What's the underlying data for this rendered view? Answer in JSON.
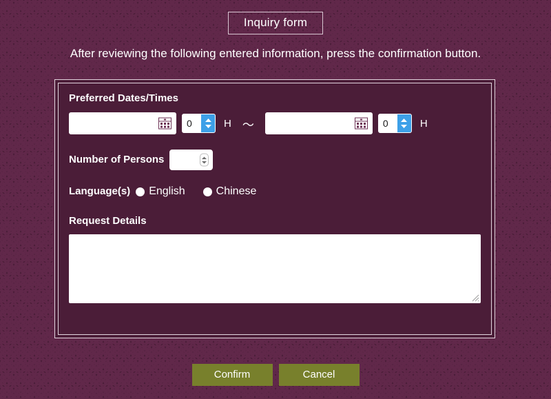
{
  "header": {
    "title": "Inquiry form",
    "instruction": "After reviewing the following entered information, press the confirmation button."
  },
  "form": {
    "fields": {
      "preferred_dates": {
        "label": "Preferred Dates/Times",
        "start": {
          "date_value": "",
          "date_icon": "calendar-icon",
          "hour_value": "0",
          "hour_unit": "H",
          "spinner_icon": "updown-chevron-icon"
        },
        "separator": "〜",
        "end": {
          "date_value": "",
          "date_icon": "calendar-icon",
          "hour_value": "0",
          "hour_unit": "H",
          "spinner_icon": "updown-chevron-icon"
        }
      },
      "number_of_persons": {
        "label": "Number of Persons",
        "value": "",
        "spinner_icon": "updown-chevron-icon"
      },
      "languages": {
        "label": "Language(s)",
        "options": [
          {
            "label": "English",
            "selected": false
          },
          {
            "label": "Chinese",
            "selected": false
          }
        ]
      },
      "request_details": {
        "label": "Request Details",
        "value": "",
        "resize_icon": "resize-grip-icon"
      }
    }
  },
  "actions": {
    "confirm_label": "Confirm",
    "cancel_label": "Cancel"
  },
  "colors": {
    "background": "#4a1d38",
    "pattern_arc": "#61284a",
    "panel_border": "#e3d4de",
    "button_green": "#78802c",
    "spinner_blue": "#3da0e8",
    "text_white": "#ffffff"
  }
}
